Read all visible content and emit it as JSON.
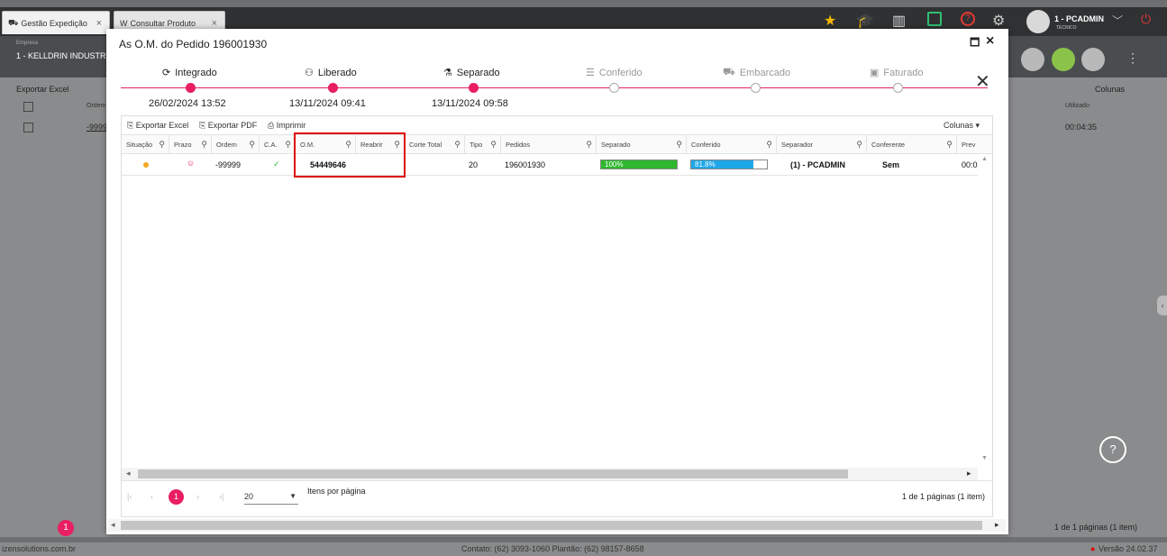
{
  "tabs": [
    {
      "label": "Gestão Expedição",
      "close": "×"
    },
    {
      "label": "Consultar Produto",
      "close": "×"
    }
  ],
  "user": {
    "name": "1 - PCADMIN",
    "role": "TECNICO"
  },
  "company": {
    "label": "Empresa",
    "value": "1 - KELLDRIN INDUSTRIA"
  },
  "background": {
    "toolbar": [
      "Exportar Excel",
      "E"
    ],
    "columns_label": "Colunas",
    "ordem_header": "Ordem",
    "ordem_value": "-9999",
    "utilizado_header": "Utilizado",
    "utilizado_value": "00:04:35",
    "page_num": "1",
    "pagination_info": "1 de 1 páginas (1 item)"
  },
  "footer": {
    "site": "izensolutions.com.br",
    "contact": "Contato: (62) 3093-1060   Plantão: (62) 98157-8658",
    "version": "Versão 24.02.37"
  },
  "modal": {
    "title": "As O.M. do Pedido 196001930",
    "maximize": "🗖",
    "close": "×",
    "steps": [
      {
        "label": "Integrado",
        "date": "26/02/2024 13:52",
        "active": true
      },
      {
        "label": "Liberado",
        "date": "13/11/2024 09:41",
        "active": true
      },
      {
        "label": "Separado",
        "date": "13/11/2024 09:58",
        "active": true
      },
      {
        "label": "Conferido",
        "date": "",
        "active": false
      },
      {
        "label": "Embarcado",
        "date": "",
        "active": false
      },
      {
        "label": "Faturado",
        "date": "",
        "active": false
      }
    ],
    "toolbar": {
      "excel": "Exportar Excel",
      "pdf": "Exportar PDF",
      "print": "Imprimir",
      "columns": "Colunas"
    },
    "headers": [
      "Situação",
      "Prazo",
      "Ordem",
      "C.A.",
      "O.M.",
      "Reabrir",
      "Corte Total",
      "Tipo",
      "Pedidos",
      "Separado",
      "Conferido",
      "Separador",
      "Conferente",
      "Prev"
    ],
    "row": {
      "ordem": "-99999",
      "om": "54449646",
      "tipo": "20",
      "pedidos": "196001930",
      "separado_label": "100%",
      "separado_pct": 100,
      "conferido_label": "81.8%",
      "conferido_pct": 81.8,
      "separador": "(1) - PCADMIN",
      "conferente": "Sem",
      "prev": "00:0"
    },
    "pager": {
      "page": "1",
      "per_page": "20",
      "per_page_label": "Itens por página",
      "info": "1 de 1 páginas (1 item)"
    }
  },
  "colors": {
    "accent": "#e91e63",
    "separado": "#2eb82e",
    "conferido": "#1ea7e8",
    "highlight": "#e00000"
  }
}
